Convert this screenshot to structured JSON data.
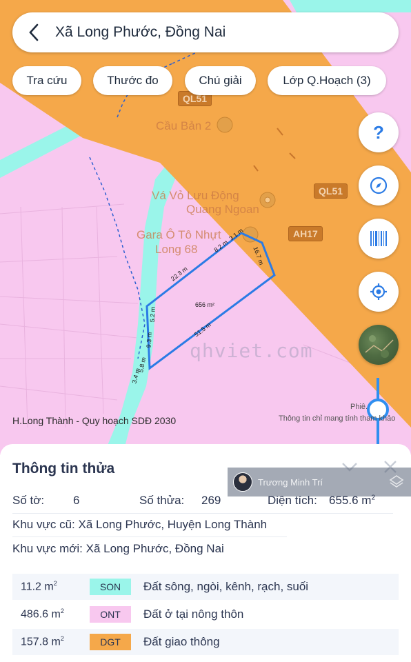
{
  "search": {
    "title": "Xã Long Phước, Đồng Nai"
  },
  "chips": [
    "Tra cứu",
    "Thước đo",
    "Chú giải",
    "Lớp Q.Hoạch (3)"
  ],
  "map": {
    "place_labels": [
      "Cầu Bản 2",
      "Vá Vỏ Lưu Động",
      "Quang Ngoan",
      "Gara Ô Tô Nhựt",
      "Long 68"
    ],
    "road_shields": [
      "QL51",
      "QL51",
      "AH17"
    ],
    "edges": [
      "22.3 m",
      "8.2 m",
      "3.1 m",
      "16.7 m",
      "51.5 m",
      "3.4 m",
      "5.8 m",
      "9.3 m",
      "5.2 m"
    ],
    "parcel_area": "656 m²",
    "watermark": "qhviet.com",
    "caption": "H.Long Thành - Quy hoạch SDĐ 2030",
    "note": "Thông tin chỉ mang tính tham khảo",
    "zoom_label": "Phiê... 1",
    "colors": {
      "residential": "#f8c8ef",
      "transport": "#f5a84a",
      "water": "#9af5ea",
      "parcel_outline": "#2b7be5"
    }
  },
  "side_buttons": [
    {
      "icon": "question-icon"
    },
    {
      "icon": "compass-icon"
    },
    {
      "icon": "barcode-icon"
    },
    {
      "icon": "locate-icon"
    },
    {
      "icon": "satellite-icon"
    }
  ],
  "panel": {
    "title": "Thông tin thửa",
    "user_overlay": "Trương Minh Trí",
    "so_to_label": "Số tờ:",
    "so_to_value": "6",
    "so_thua_label": "Số thửa:",
    "so_thua_value": "269",
    "dien_tich_label": "Diện tích:",
    "dien_tich_value": "655.6 m",
    "dien_tich_unit_sup": "2",
    "khu_vuc_cu": "Khu vực cũ: Xã Long Phước, Huyện Long Thành",
    "khu_vuc_moi": "Khu vực mới: Xã Long Phước, Đồng Nai",
    "land_uses": [
      {
        "area": "11.2 m",
        "sup": "2",
        "code": "SON",
        "color": "#9af5ea",
        "desc": "Đất sông, ngòi, kênh, rạch, suối"
      },
      {
        "area": "486.6 m",
        "sup": "2",
        "code": "ONT",
        "color": "#f8c8ef",
        "desc": "Đất ở tại nông thôn"
      },
      {
        "area": "157.8 m",
        "sup": "2",
        "code": "DGT",
        "color": "#f5a84a",
        "desc": "Đất giao thông"
      }
    ]
  }
}
